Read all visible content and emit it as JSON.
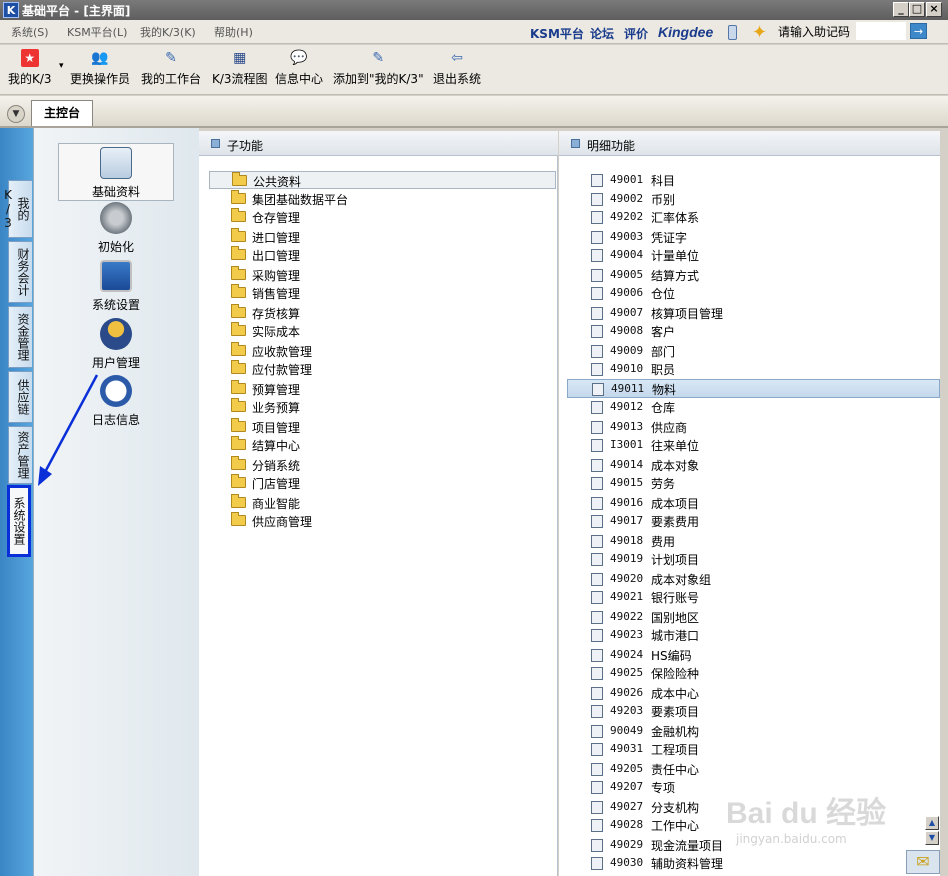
{
  "window": {
    "logo": "K",
    "title": "基础平台 - [主界面]",
    "min": "_",
    "max": "□",
    "close": "×"
  },
  "menubar": {
    "items": [
      "系统(S)",
      "KSM平台(L)",
      "我的K/3(K)",
      "帮助(H)"
    ],
    "links": [
      "KSM平台",
      "论坛",
      "评价"
    ],
    "brand": "Kingdee",
    "help_label": "请输入助记码",
    "help_value": "",
    "go_icon": "→"
  },
  "toolbar": {
    "items": [
      {
        "label": "我的K/3",
        "icon": "star-icon"
      },
      {
        "label": "更换操作员",
        "icon": "users-icon"
      },
      {
        "label": "我的工作台",
        "icon": "pen-icon"
      },
      {
        "label": "K/3流程图",
        "icon": "flowchart-icon"
      },
      {
        "label": "信息中心",
        "icon": "message-icon"
      },
      {
        "label": "添加到\"我的K/3\"",
        "icon": "add-favorite-icon"
      },
      {
        "label": "退出系统",
        "icon": "exit-icon"
      }
    ],
    "dropdown_arrow": "▾"
  },
  "tabs": {
    "dropdown": "▼",
    "main_tab": "主控台"
  },
  "side_tabs": [
    "我的K/3",
    "财务会计",
    "资金管理",
    "供应链",
    "资产管理",
    "系统设置"
  ],
  "modules": [
    "基础资料",
    "初始化",
    "系统设置",
    "用户管理",
    "日志信息"
  ],
  "subfunc": {
    "header": "子功能",
    "items": [
      "公共资料",
      "集团基础数据平台",
      "仓存管理",
      "进口管理",
      "出口管理",
      "采购管理",
      "销售管理",
      "存货核算",
      "实际成本",
      "应收款管理",
      "应付款管理",
      "预算管理",
      "业务预算",
      "项目管理",
      "结算中心",
      "分销系统",
      "门店管理",
      "商业智能",
      "供应商管理"
    ]
  },
  "detail": {
    "header": "明细功能",
    "items": [
      {
        "code": "49001",
        "label": "科目"
      },
      {
        "code": "49002",
        "label": "币别"
      },
      {
        "code": "49202",
        "label": "汇率体系"
      },
      {
        "code": "49003",
        "label": "凭证字"
      },
      {
        "code": "49004",
        "label": "计量单位"
      },
      {
        "code": "49005",
        "label": "结算方式"
      },
      {
        "code": "49006",
        "label": "仓位"
      },
      {
        "code": "49007",
        "label": "核算项目管理"
      },
      {
        "code": "49008",
        "label": "客户"
      },
      {
        "code": "49009",
        "label": "部门"
      },
      {
        "code": "49010",
        "label": "职员"
      },
      {
        "code": "49011",
        "label": "物料"
      },
      {
        "code": "49012",
        "label": "仓库"
      },
      {
        "code": "49013",
        "label": "供应商"
      },
      {
        "code": "I3001",
        "label": "往来单位"
      },
      {
        "code": "49014",
        "label": "成本对象"
      },
      {
        "code": "49015",
        "label": "劳务"
      },
      {
        "code": "49016",
        "label": "成本项目"
      },
      {
        "code": "49017",
        "label": "要素费用"
      },
      {
        "code": "49018",
        "label": "费用"
      },
      {
        "code": "49019",
        "label": "计划项目"
      },
      {
        "code": "49020",
        "label": "成本对象组"
      },
      {
        "code": "49021",
        "label": "银行账号"
      },
      {
        "code": "49022",
        "label": "国别地区"
      },
      {
        "code": "49023",
        "label": "城市港口"
      },
      {
        "code": "49024",
        "label": "HS编码"
      },
      {
        "code": "49025",
        "label": "保险险种"
      },
      {
        "code": "49026",
        "label": "成本中心"
      },
      {
        "code": "49203",
        "label": "要素项目"
      },
      {
        "code": "90049",
        "label": "金融机构"
      },
      {
        "code": "49031",
        "label": "工程项目"
      },
      {
        "code": "49205",
        "label": "责任中心"
      },
      {
        "code": "49207",
        "label": "专项"
      },
      {
        "code": "49027",
        "label": "分支机构"
      },
      {
        "code": "49028",
        "label": "工作中心"
      },
      {
        "code": "49029",
        "label": "现金流量项目"
      },
      {
        "code": "49030",
        "label": "辅助资料管理"
      }
    ]
  },
  "scroll": {
    "up": "▲",
    "down": "▼"
  },
  "mail_icon": "✉",
  "watermark": {
    "brand": "Bai du 经验",
    "url": "jingyan.baidu.com"
  },
  "colors": {
    "annotation_blue": "#0a2fd8",
    "side_blue": "#3a85c5"
  }
}
